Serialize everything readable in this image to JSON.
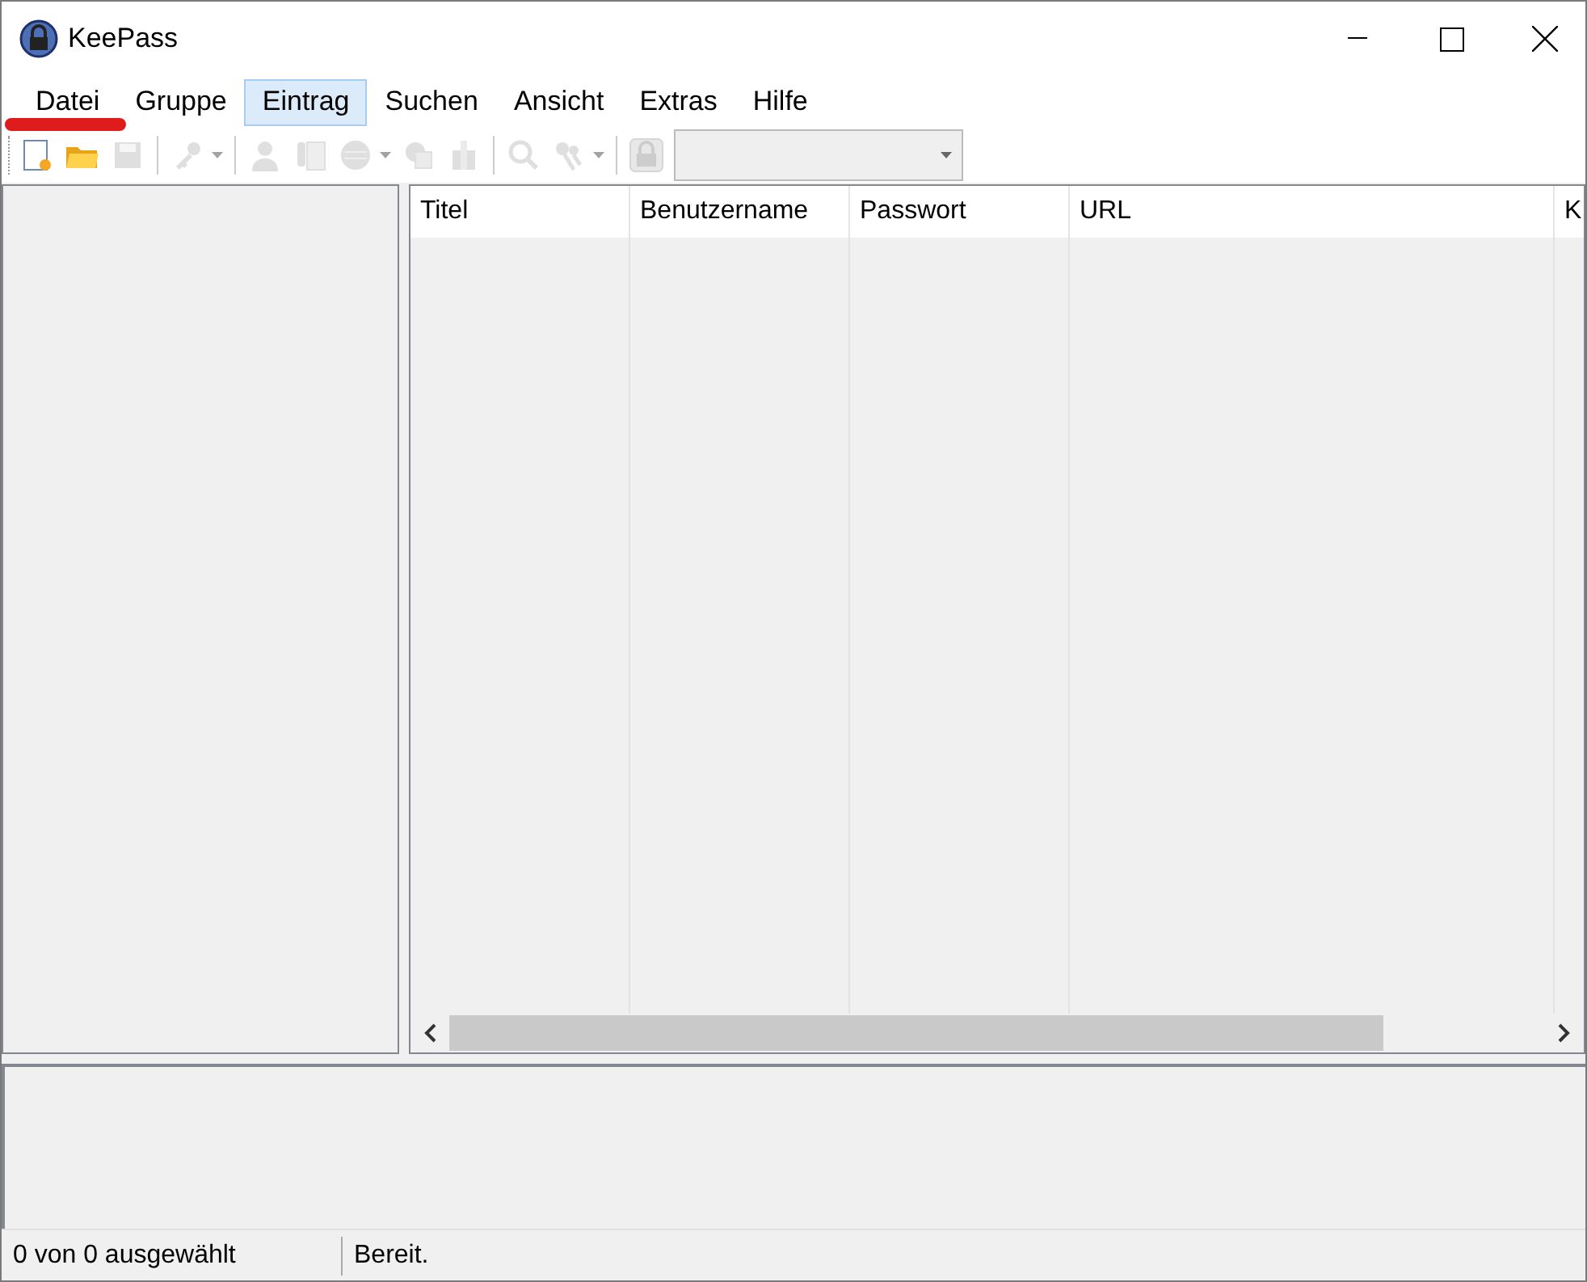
{
  "window": {
    "title": "KeePass"
  },
  "menu": [
    {
      "label": "Datei",
      "selected": false,
      "annotated": true
    },
    {
      "label": "Gruppe",
      "selected": false,
      "annotated": false
    },
    {
      "label": "Eintrag",
      "selected": true,
      "annotated": false
    },
    {
      "label": "Suchen",
      "selected": false,
      "annotated": false
    },
    {
      "label": "Ansicht",
      "selected": false,
      "annotated": false
    },
    {
      "label": "Extras",
      "selected": false,
      "annotated": false
    },
    {
      "label": "Hilfe",
      "selected": false,
      "annotated": false
    }
  ],
  "toolbar": [
    {
      "kind": "button",
      "disabled": false,
      "dropdown": false
    },
    {
      "kind": "button",
      "disabled": false,
      "dropdown": false
    },
    {
      "kind": "button",
      "disabled": true,
      "dropdown": false
    },
    {
      "kind": "separator"
    },
    {
      "kind": "button",
      "disabled": true,
      "dropdown": true
    },
    {
      "kind": "separator"
    },
    {
      "kind": "button",
      "disabled": true,
      "dropdown": false
    },
    {
      "kind": "button",
      "disabled": true,
      "dropdown": false
    },
    {
      "kind": "button",
      "disabled": true,
      "dropdown": true
    },
    {
      "kind": "button",
      "disabled": true,
      "dropdown": false
    },
    {
      "kind": "button",
      "disabled": true,
      "dropdown": false
    },
    {
      "kind": "separator"
    },
    {
      "kind": "button",
      "disabled": true,
      "dropdown": false
    },
    {
      "kind": "button",
      "disabled": true,
      "dropdown": true
    },
    {
      "kind": "separator"
    },
    {
      "kind": "button",
      "disabled": true,
      "dropdown": false
    },
    {
      "kind": "combo",
      "disabled": true
    }
  ],
  "table": {
    "columns": [
      "Titel",
      "Benutzername",
      "Passwort",
      "URL",
      "K"
    ]
  },
  "status_bar": [
    "0 von 0 ausgewählt",
    "Bereit."
  ]
}
